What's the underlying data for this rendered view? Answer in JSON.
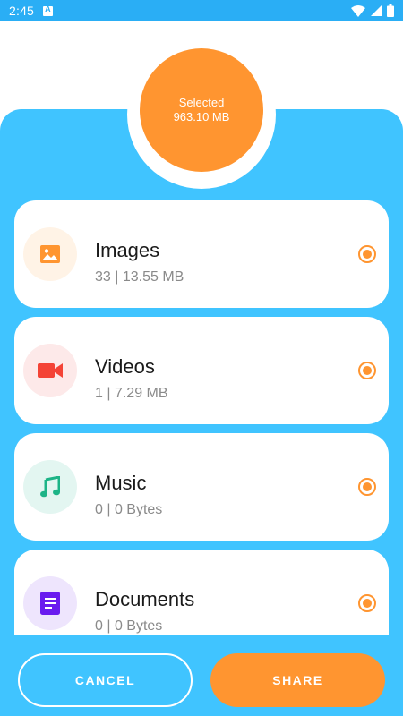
{
  "status_bar": {
    "time": "2:45"
  },
  "summary": {
    "label": "Selected",
    "size": "963.10 MB"
  },
  "categories": [
    {
      "title": "Images",
      "subtitle": "33 | 13.55 MB",
      "icon": "image-icon",
      "icon_color": "#ff9530",
      "icon_bg": "#fff3e6",
      "selected": true
    },
    {
      "title": "Videos",
      "subtitle": "1 | 7.29 MB",
      "icon": "video-camera-icon",
      "icon_color": "#f44336",
      "icon_bg": "#fde9e9",
      "selected": true
    },
    {
      "title": "Music",
      "subtitle": "0 | 0 Bytes",
      "icon": "music-note-icon",
      "icon_color": "#1db487",
      "icon_bg": "#e3f6f1",
      "selected": true
    },
    {
      "title": "Documents",
      "subtitle": "0 | 0 Bytes",
      "icon": "document-icon",
      "icon_color": "#6a1bef",
      "icon_bg": "#eee5fd",
      "selected": true
    }
  ],
  "actions": {
    "cancel_label": "CANCEL",
    "share_label": "SHARE"
  },
  "colors": {
    "status_bar": "#2aaef5",
    "panel": "#40c4ff",
    "accent": "#ff9530"
  }
}
